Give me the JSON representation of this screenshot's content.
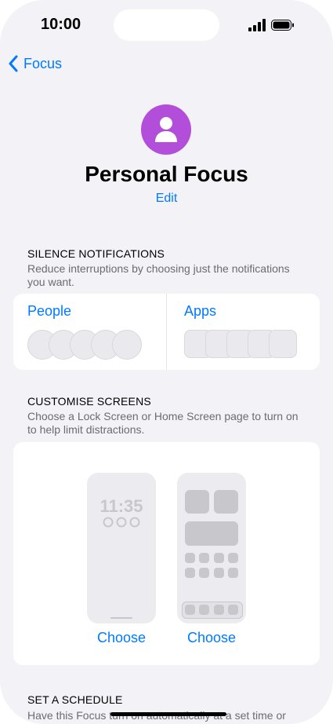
{
  "status": {
    "time": "10:00"
  },
  "nav": {
    "back_label": "Focus"
  },
  "header": {
    "title": "Personal Focus",
    "edit_label": "Edit"
  },
  "silence": {
    "heading": "SILENCE NOTIFICATIONS",
    "description": "Reduce interruptions by choosing just the notifications you want.",
    "people_label": "People",
    "apps_label": "Apps"
  },
  "customise": {
    "heading": "CUSTOMISE SCREENS",
    "description": "Choose a Lock Screen or Home Screen page to turn on to help limit distractions.",
    "lock_preview_time": "11:35",
    "lock_choose_label": "Choose",
    "home_choose_label": "Choose"
  },
  "schedule": {
    "heading": "SET A SCHEDULE",
    "description": "Have this Focus turn on automatically at a set time or"
  },
  "colors": {
    "accent": "#007aff",
    "avatar": "#b24ed9",
    "background": "#f2f2f7"
  }
}
